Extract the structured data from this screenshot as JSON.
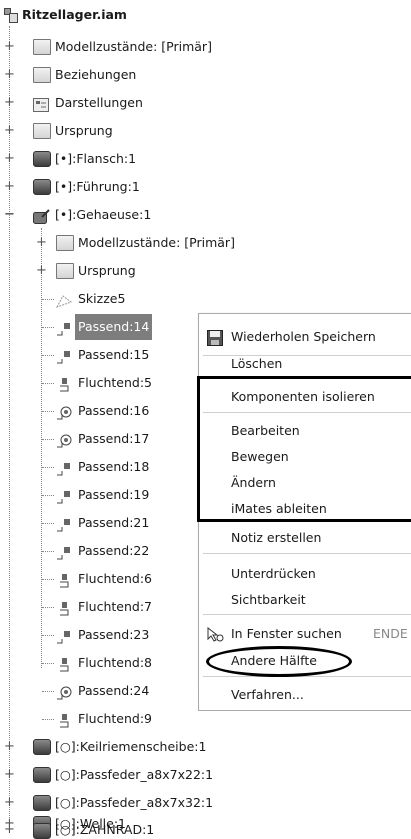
{
  "tree": {
    "root": "Ritzellager.iam",
    "top_items": [
      "Modellzustände: [Primär]",
      "Beziehungen",
      "Darstellungen",
      "Ursprung",
      "[•]:Flansch:1",
      "[•]:Führung:1",
      "[•]:Gehaeuse:1"
    ],
    "gehaeuse_children": [
      "Modellzustände: [Primär]",
      "Ursprung",
      "Skizze5",
      "Passend:14",
      "Passend:15",
      "Fluchtend:5",
      "Passend:16",
      "Passend:17",
      "Passend:18",
      "Passend:19",
      "Passend:21",
      "Passend:22",
      "Fluchtend:6",
      "Fluchtend:7",
      "Passend:23",
      "Fluchtend:8",
      "Passend:24",
      "Fluchtend:9"
    ],
    "bottom_items": [
      "[○]:Keilriemenscheibe:1",
      "[○]:Passfeder_a8x7x22:1",
      "[○]:Passfeder_a8x7x32:1",
      "[○]:Welle:1",
      "[○]:ZAHNRAD:1"
    ]
  },
  "context_menu": {
    "items": [
      "Wiederholen Speichern",
      "Löschen",
      "Komponenten isolieren",
      "Bearbeiten",
      "Bewegen",
      "Ändern",
      "iMates ableiten",
      "Notiz erstellen",
      "Unterdrücken",
      "Sichtbarkeit",
      "In Fenster suchen",
      "Andere Hälfte",
      "Verfahren..."
    ],
    "shortcut": "ENDE"
  }
}
